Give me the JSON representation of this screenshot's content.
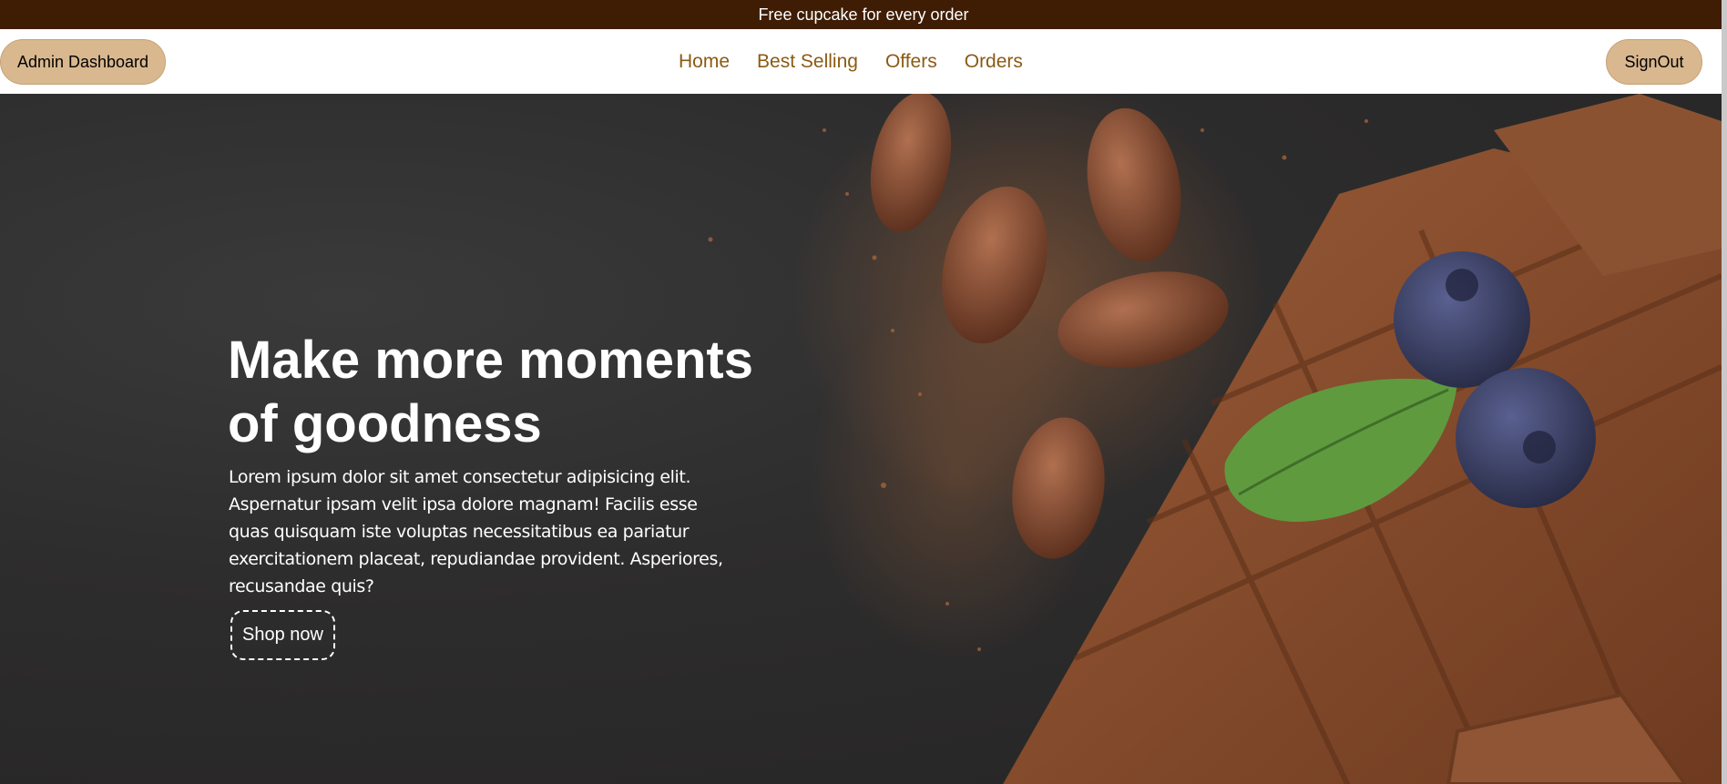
{
  "promo": {
    "text": "Free cupcake for every order"
  },
  "nav": {
    "admin_label": "Admin Dashboard",
    "links": [
      {
        "label": "Home"
      },
      {
        "label": "Best Selling"
      },
      {
        "label": "Offers"
      },
      {
        "label": "Orders"
      }
    ],
    "signout_label": "SignOut"
  },
  "hero": {
    "title_line1": "Make more moments",
    "title_line2": "of goodness",
    "description": "Lorem ipsum dolor sit amet consectetur adipisicing elit. Aspernatur ipsam velit ipsa dolore magnam! Facilis esse quas quisquam iste voluptas necessitatibus ea pariatur exercitationem placeat, repudiandae provident. Asperiores, recusandae quis?",
    "cta_label": "Shop now",
    "image_subject": "chocolate-bar-with-cocoa-beans-blueberries-and-mint"
  },
  "colors": {
    "promo_bg": "#3f1d04",
    "nav_link": "#8b5a13",
    "button_bg": "#d9b88f",
    "hero_bg": "#2e2d2d",
    "chocolate": "#8a5131",
    "cocoa_powder": "#b06a3b",
    "mint": "#5f9a3f",
    "blueberry": "#3f4468"
  }
}
